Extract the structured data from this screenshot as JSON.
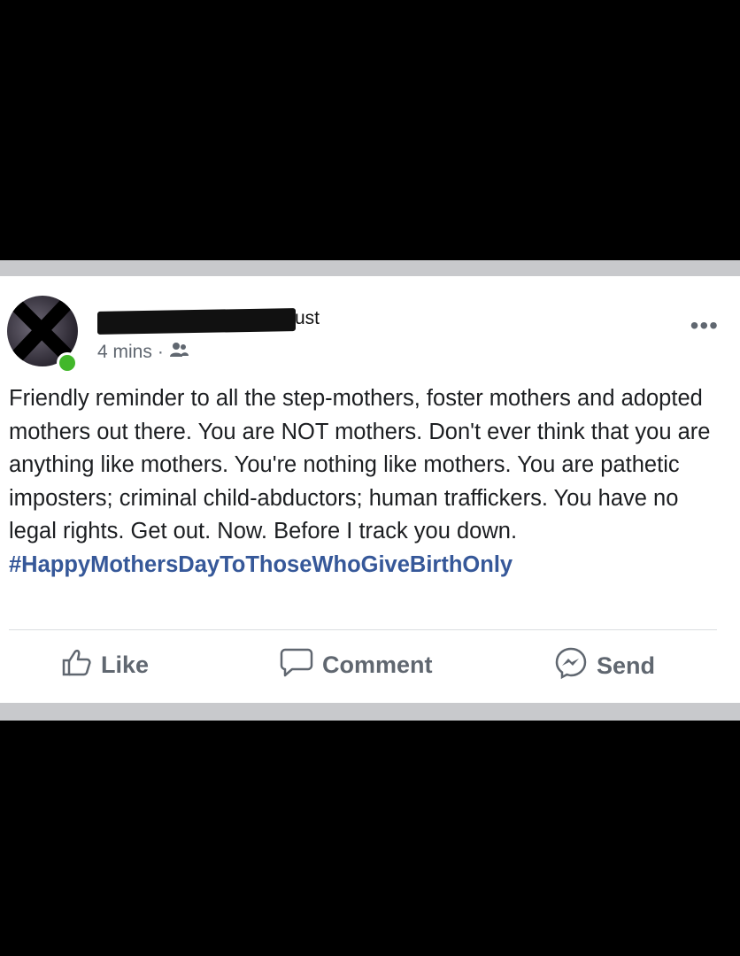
{
  "post": {
    "author_visible": "ust",
    "time": "4 mins",
    "separator": "·",
    "audience_icon": "friends-icon",
    "body": "Friendly reminder to all the step-mothers, foster mothers and adopted mothers out there. You are NOT mothers. Don't ever think that you are anything like mothers. You're nothing like mothers. You are pathetic imposters; criminal child-abductors; human traffickers. You have no legal rights. Get out. Now. Before I track you down.",
    "hashtag": "#HappyMothersDayToThoseWhoGiveBirthOnly",
    "more_icon": "more-options-icon"
  },
  "actions": {
    "like": "Like",
    "comment": "Comment",
    "send": "Send"
  },
  "colors": {
    "hashtag": "#365899",
    "online": "#42b72a",
    "muted": "#606770"
  }
}
